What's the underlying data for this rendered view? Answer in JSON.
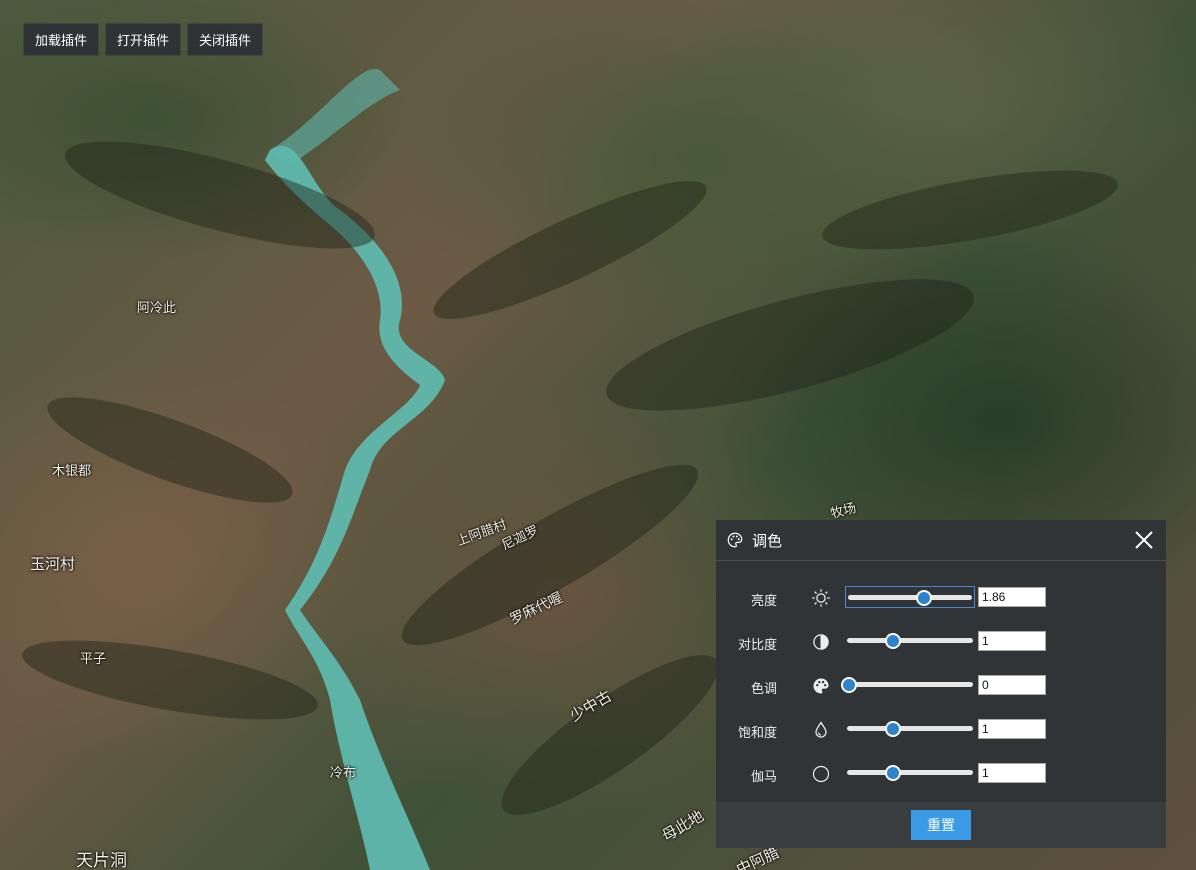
{
  "toolbar": {
    "buttons": [
      "加载插件",
      "打开插件",
      "关闭插件"
    ]
  },
  "map_labels": [
    {
      "text": "阿冷此"
    },
    {
      "text": "木银都"
    },
    {
      "text": "玉河村"
    },
    {
      "text": "平子"
    },
    {
      "text": "冷布"
    },
    {
      "text": "天片洞"
    },
    {
      "text": "上阿腊村"
    },
    {
      "text": "尼迦罗"
    },
    {
      "text": "罗麻代喔"
    },
    {
      "text": "少中古"
    },
    {
      "text": "母此地"
    },
    {
      "text": "中阿腊"
    },
    {
      "text": "牧场"
    }
  ],
  "panel": {
    "title": "调色",
    "rows": [
      {
        "label": "亮度",
        "icon": "sun-icon",
        "value": "1.86",
        "fraction": 0.61
      },
      {
        "label": "对比度",
        "icon": "contrast-icon",
        "value": "1",
        "fraction": 0.36
      },
      {
        "label": "色调",
        "icon": "palette-icon",
        "value": "0",
        "fraction": 0.0
      },
      {
        "label": "饱和度",
        "icon": "drop-icon",
        "value": "1",
        "fraction": 0.36
      },
      {
        "label": "伽马",
        "icon": "circle-icon",
        "value": "1",
        "fraction": 0.36
      }
    ],
    "reset_label": "重置"
  },
  "colors": {
    "panel_bg": "#303336",
    "accent": "#2d83c9",
    "reset_button": "#3a9ae6",
    "river": "#5fb8ad"
  }
}
